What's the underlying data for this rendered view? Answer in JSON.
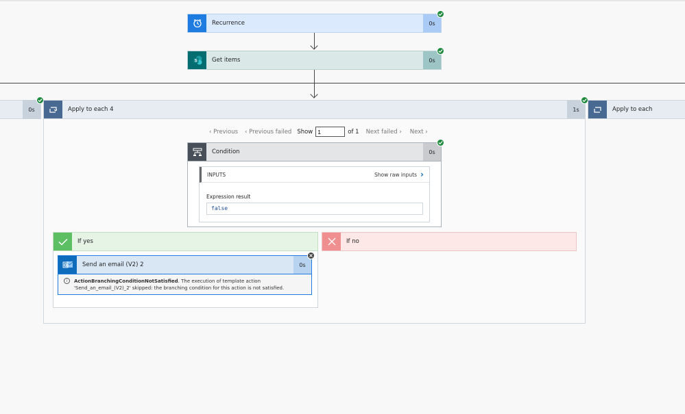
{
  "steps": {
    "recurrence": {
      "title": "Recurrence",
      "duration": "0s",
      "icon": "alarm-clock-icon"
    },
    "get_items": {
      "title": "Get items",
      "duration": "0s",
      "icon": "sharepoint-icon"
    }
  },
  "left_loop": {
    "duration": "0s"
  },
  "apply_each_4": {
    "title": "Apply to each 4",
    "duration": "1s",
    "icon": "loop-icon"
  },
  "apply_each": {
    "title": "Apply to each",
    "icon": "loop-icon"
  },
  "pager": {
    "previous": "Previous",
    "previous_failed": "Previous failed",
    "show": "Show",
    "page_value": "1",
    "of": "of 1",
    "next_failed": "Next failed",
    "next": "Next"
  },
  "condition": {
    "title": "Condition",
    "duration": "0s",
    "inputs_label": "INPUTS",
    "show_raw": "Show raw inputs",
    "expr_label": "Expression result",
    "expr_value": "false"
  },
  "branches": {
    "yes": {
      "label": "If yes"
    },
    "no": {
      "label": "If no"
    }
  },
  "email": {
    "title": "Send an email (V2) 2",
    "duration": "0s",
    "error_code": "ActionBranchingConditionNotSatisfied",
    "error_msg_1": ". The execution of template action",
    "error_msg_2": "'Send_an_email_(V2)_2' skipped: the branching condition for this action is not satisfied."
  },
  "colors": {
    "recurrence_icon": "#1e7be0",
    "sharepoint_icon": "#036c70",
    "loop_icon": "#486991",
    "condition_icon": "#484f58",
    "outlook_icon": "#0f6cbd",
    "success": "#1f8a3e"
  }
}
